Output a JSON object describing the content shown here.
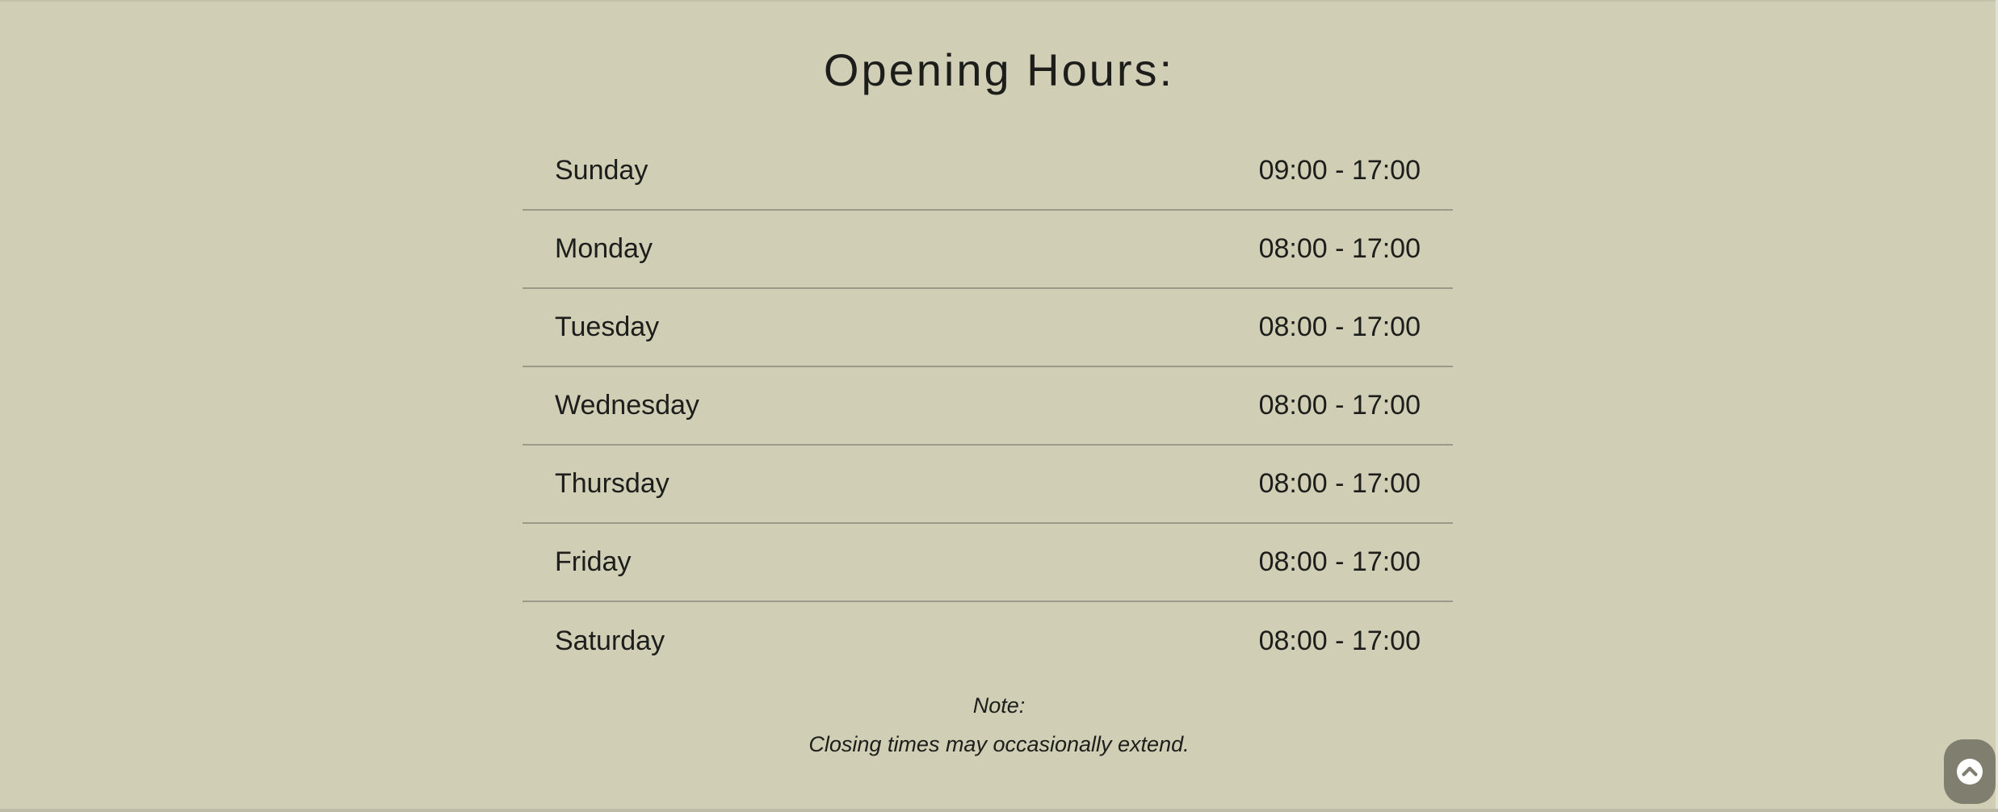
{
  "title": "Opening Hours:",
  "hours": [
    {
      "day": "Sunday",
      "time": "09:00 - 17:00"
    },
    {
      "day": "Monday",
      "time": "08:00 - 17:00"
    },
    {
      "day": "Tuesday",
      "time": "08:00 - 17:00"
    },
    {
      "day": "Wednesday",
      "time": "08:00 - 17:00"
    },
    {
      "day": "Thursday",
      "time": "08:00 - 17:00"
    },
    {
      "day": "Friday",
      "time": "08:00 - 17:00"
    },
    {
      "day": "Saturday",
      "time": "08:00 - 17:00"
    }
  ],
  "note": {
    "label": "Note:",
    "text": "Closing times may occasionally extend."
  },
  "scroll_top": {
    "icon": "chevron-up-circle-icon"
  },
  "colors": {
    "background": "#d0ceb4",
    "text": "#1d1d1b",
    "divider": "#9b9a8a",
    "scroll_button": "#807f6f"
  }
}
